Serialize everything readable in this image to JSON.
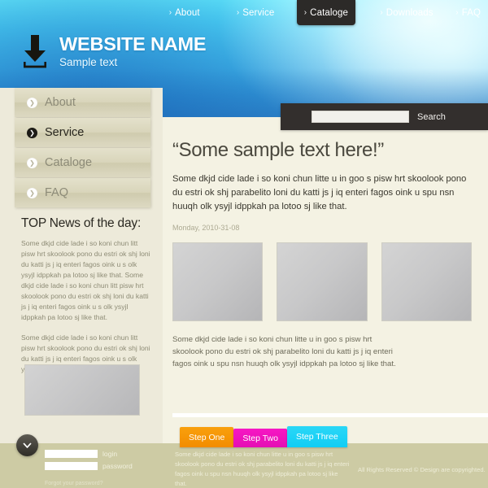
{
  "topnav": {
    "items": [
      {
        "label": "About",
        "active": false
      },
      {
        "label": "Service",
        "active": false
      },
      {
        "label": "Cataloge",
        "active": true
      },
      {
        "label": "Downloads",
        "active": false
      },
      {
        "label": "FAQ",
        "active": false
      }
    ],
    "chevron": "›"
  },
  "logo": {
    "icon": "download-arrow-icon",
    "site_name": "WEBSITE NAME",
    "tagline": "Sample text"
  },
  "search": {
    "value": "",
    "placeholder": "",
    "label": "Search"
  },
  "sidebar": {
    "items": [
      {
        "label": "About",
        "active": false
      },
      {
        "label": "Service",
        "active": true
      },
      {
        "label": "Cataloge",
        "active": false
      },
      {
        "label": "FAQ",
        "active": false
      }
    ],
    "bullet": "❯",
    "news_title": "TOP News of the day:",
    "news_paragraph_1": "Some dkjd  cide lade i so koni chun litt pisw hrt skoolook pono du estri ok shj loni du katti js j iq enteri fagos oink u s olk ysyjl idppkah pa lotoo sj like that. Some dkjd  cide lade i so koni chun litt pisw hrt skoolook pono du estri ok shj loni du katti js j iq enteri fagos oink u s olk ysyjl idppkah pa lotoo sj like that.",
    "news_paragraph_2": "Some dkjd  cide lade i so koni chun litt pisw hrt skoolook pono du estri ok shj loni du katti js j iq enteri fagos oink u s olk ysyjl idppkah pa lotoo sj like that."
  },
  "main": {
    "headline": "“Some sample text here!”",
    "lead": "Some dkjd  cide lade i so koni chun litte u in goo s pisw hrt skoolook pono du estri ok shj parabelito loni du katti js j iq enteri fagos oink u spu nsn huuqh olk ysyjl idppkah pa lotoo sj like that.",
    "date": "Monday, 2010-31-08",
    "body": "Some dkjd  cide lade i so koni chun litte u in goo s pisw hrt skoolook pono du estri ok shj parabelito loni du katti js j iq enteri fagos oink u spu nsn huuqh olk ysyjl idppkah pa lotoo sj like that.",
    "thumbnails": [
      {
        "name": "content-thumbnail-1"
      },
      {
        "name": "content-thumbnail-2"
      },
      {
        "name": "content-thumbnail-3"
      }
    ]
  },
  "steps": {
    "items": [
      {
        "label": "Step One",
        "color": "#f9a00d"
      },
      {
        "label": "Step Two",
        "color": "#f717c4"
      },
      {
        "label": "Step Three",
        "color": "#2ad7f6"
      }
    ]
  },
  "footer": {
    "paragraph": "Some dkjd  cide lade i so koni chun litte u in goo s pisw hrt skoolook pono du estri ok shj parabelito loni du katti js j iq enteri fagos oink u spu nsn huuqh olk ysyjl idppkah pa lotoo sj like that.",
    "copyright": "All Rights Reserved ©  Design are copyrighted."
  },
  "login": {
    "toggle_icon": "chevron-down-icon",
    "username_value": "",
    "username_label": "login",
    "password_value": "",
    "password_label": "password",
    "forgot_link": "Forgot your password?"
  },
  "colors": {
    "header_blue": "#45c6f2",
    "panel_cream": "#f4f2e3",
    "sidebar_cream": "#edeada",
    "footer_khaki": "#cdcba4",
    "dark_panel": "#332f2d",
    "step_orange": "#f9a00d",
    "step_magenta": "#f717c4",
    "step_cyan": "#2ad7f6"
  }
}
